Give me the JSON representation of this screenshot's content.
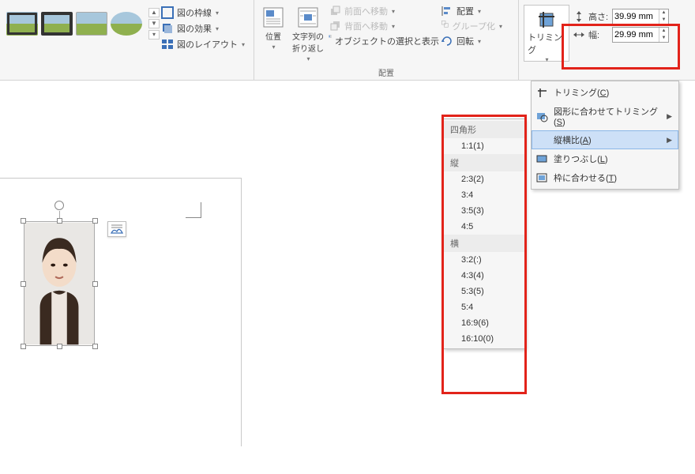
{
  "ribbon": {
    "picture_styles": {
      "border": "図の枠線",
      "effects": "図の効果",
      "layout": "図のレイアウト"
    },
    "arrange": {
      "position": "位置",
      "wrap": "文字列の\n折り返し",
      "bring_forward": "前面へ移動",
      "send_backward": "背面へ移動",
      "selection_pane": "オブジェクトの選択と表示",
      "align": "配置",
      "group": "グループ化",
      "rotate": "回転",
      "group_label": "配置"
    },
    "trim": {
      "label": "トリミング"
    },
    "size": {
      "height_label": "高さ:",
      "height_value": "39.99 mm",
      "width_label": "幅:",
      "width_value": "29.99 mm"
    }
  },
  "trim_menu": {
    "trim": "トリミング(C)",
    "to_shape": "図形に合わせてトリミング(S)",
    "aspect": "縦横比(A)",
    "fill": "塗りつぶし(L)",
    "fit": "枠に合わせる(T)"
  },
  "aspect_menu": {
    "square_hdr": "四角形",
    "square_11": "1:1(1)",
    "vert_hdr": "縦",
    "v_23": "2:3(2)",
    "v_34": "3:4",
    "v_35": "3:5(3)",
    "v_45": "4:5",
    "horiz_hdr": "横",
    "h_32": "3:2(:)",
    "h_43": "4:3(4)",
    "h_53": "5:3(5)",
    "h_54": "5:4",
    "h_169": "16:9(6)",
    "h_1610": "16:10(0)"
  }
}
